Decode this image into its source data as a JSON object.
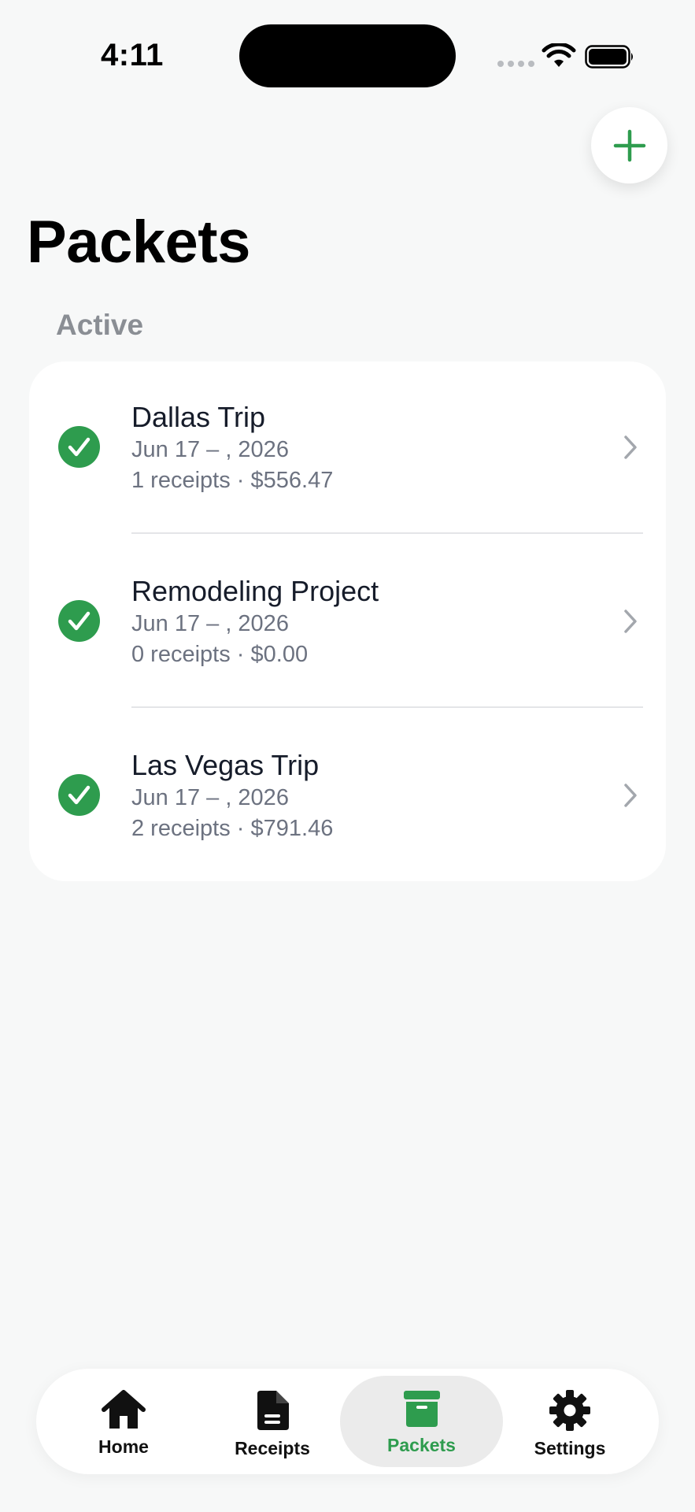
{
  "status_bar": {
    "time": "4:11"
  },
  "header": {
    "title": "Packets",
    "add_button_icon": "plus-icon"
  },
  "section": {
    "label": "Active"
  },
  "packets": [
    {
      "title": "Dallas Trip",
      "dates": "Jun 17 – , 2026",
      "summary": "1 receipts · $556.47",
      "status": "check-circle-icon"
    },
    {
      "title": "Remodeling Project",
      "dates": "Jun 17 – , 2026",
      "summary": "0 receipts · $0.00",
      "status": "check-circle-icon"
    },
    {
      "title": "Las Vegas Trip",
      "dates": "Jun 17 – , 2026",
      "summary": "2 receipts · $791.46",
      "status": "check-circle-icon"
    }
  ],
  "tabs": [
    {
      "label": "Home",
      "icon": "home-icon",
      "active": false
    },
    {
      "label": "Receipts",
      "icon": "document-icon",
      "active": false
    },
    {
      "label": "Packets",
      "icon": "archive-box-icon",
      "active": true
    },
    {
      "label": "Settings",
      "icon": "gear-icon",
      "active": false
    }
  ],
  "colors": {
    "accent": "#2e9c4e",
    "background": "#f7f8f8",
    "card": "#ffffff",
    "secondary_text": "#6c7280"
  }
}
